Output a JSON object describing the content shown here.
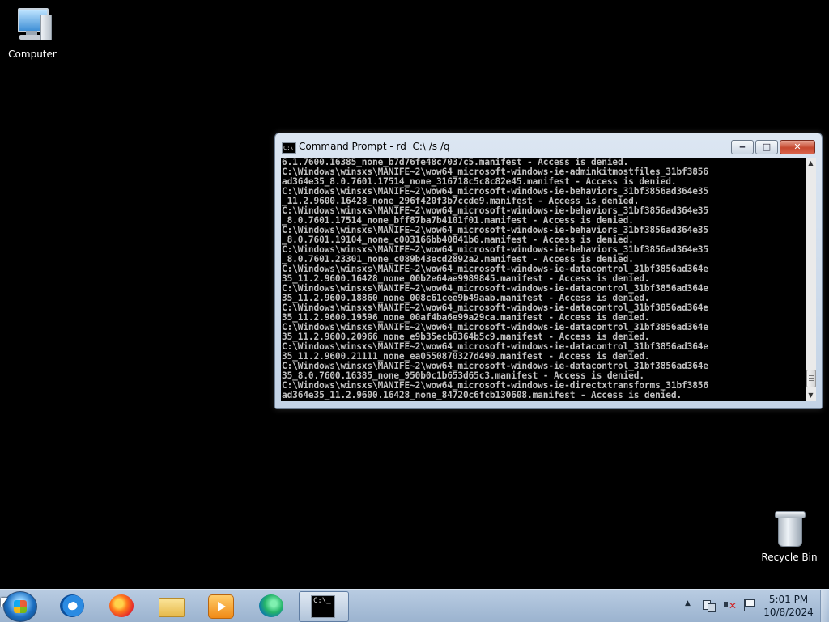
{
  "desktop": {
    "icons": [
      {
        "label": "Computer",
        "icon": "computer-icon"
      },
      {
        "label": "Recycle Bin",
        "icon": "recycle-bin-icon"
      }
    ]
  },
  "window": {
    "title": "Command Prompt - rd  C:\\ /s /q",
    "icon": "cmd-icon",
    "buttons": {
      "minimize": "minimize-icon",
      "maximize": "maximize-icon",
      "close": "close-icon"
    },
    "console_lines": [
      "6.1.7600.16385_none_b7d76fe48c7037c5.manifest - Access is denied.",
      "C:\\Windows\\winsxs\\MANIFE~2\\wow64_microsoft-windows-ie-adminkitmostfiles_31bf3856",
      "ad364e35_8.0.7601.17514_none_316718c5c8c82e45.manifest - Access is denied.",
      "C:\\Windows\\winsxs\\MANIFE~2\\wow64_microsoft-windows-ie-behaviors_31bf3856ad364e35",
      "_11.2.9600.16428_none_296f420f3b7ccde9.manifest - Access is denied.",
      "C:\\Windows\\winsxs\\MANIFE~2\\wow64_microsoft-windows-ie-behaviors_31bf3856ad364e35",
      "_8.0.7601.17514_none_bff87ba7b4101f01.manifest - Access is denied.",
      "C:\\Windows\\winsxs\\MANIFE~2\\wow64_microsoft-windows-ie-behaviors_31bf3856ad364e35",
      "_8.0.7601.19104_none_c003166bb40841b6.manifest - Access is denied.",
      "C:\\Windows\\winsxs\\MANIFE~2\\wow64_microsoft-windows-ie-behaviors_31bf3856ad364e35",
      "_8.0.7601.23301_none_c089b43ecd2892a2.manifest - Access is denied.",
      "C:\\Windows\\winsxs\\MANIFE~2\\wow64_microsoft-windows-ie-datacontrol_31bf3856ad364e",
      "35_11.2.9600.16428_none_00b2e64ae9989845.manifest - Access is denied.",
      "C:\\Windows\\winsxs\\MANIFE~2\\wow64_microsoft-windows-ie-datacontrol_31bf3856ad364e",
      "35_11.2.9600.18860_none_008c61cee9b49aab.manifest - Access is denied.",
      "C:\\Windows\\winsxs\\MANIFE~2\\wow64_microsoft-windows-ie-datacontrol_31bf3856ad364e",
      "35_11.2.9600.19596_none_00af4ba6e99a29ca.manifest - Access is denied.",
      "C:\\Windows\\winsxs\\MANIFE~2\\wow64_microsoft-windows-ie-datacontrol_31bf3856ad364e",
      "35_11.2.9600.20966_none_e9b35ecb0364b5c9.manifest - Access is denied.",
      "C:\\Windows\\winsxs\\MANIFE~2\\wow64_microsoft-windows-ie-datacontrol_31bf3856ad364e",
      "35_11.2.9600.21111_none_ea0550870327d490.manifest - Access is denied.",
      "C:\\Windows\\winsxs\\MANIFE~2\\wow64_microsoft-windows-ie-datacontrol_31bf3856ad364e",
      "35_8.0.7600.16385_none_950b0c1b653d65c3.manifest - Access is denied.",
      "C:\\Windows\\winsxs\\MANIFE~2\\wow64_microsoft-windows-ie-directxtransforms_31bf3856",
      "ad364e35_11.2.9600.16428_none_84720c6fcb130608.manifest - Access is denied."
    ]
  },
  "taskbar": {
    "apps": [
      {
        "name": "internet-explorer",
        "icon": "ie-icon"
      },
      {
        "name": "firefox",
        "icon": "firefox-icon"
      },
      {
        "name": "windows-explorer",
        "icon": "folder-icon"
      },
      {
        "name": "media-player",
        "icon": "media-player-icon"
      },
      {
        "name": "edge",
        "icon": "edge-icon"
      },
      {
        "name": "command-prompt",
        "icon": "cmd-icon",
        "active": true
      }
    ],
    "clock": {
      "time": "5:01 PM",
      "date": "10/8/2024"
    }
  }
}
